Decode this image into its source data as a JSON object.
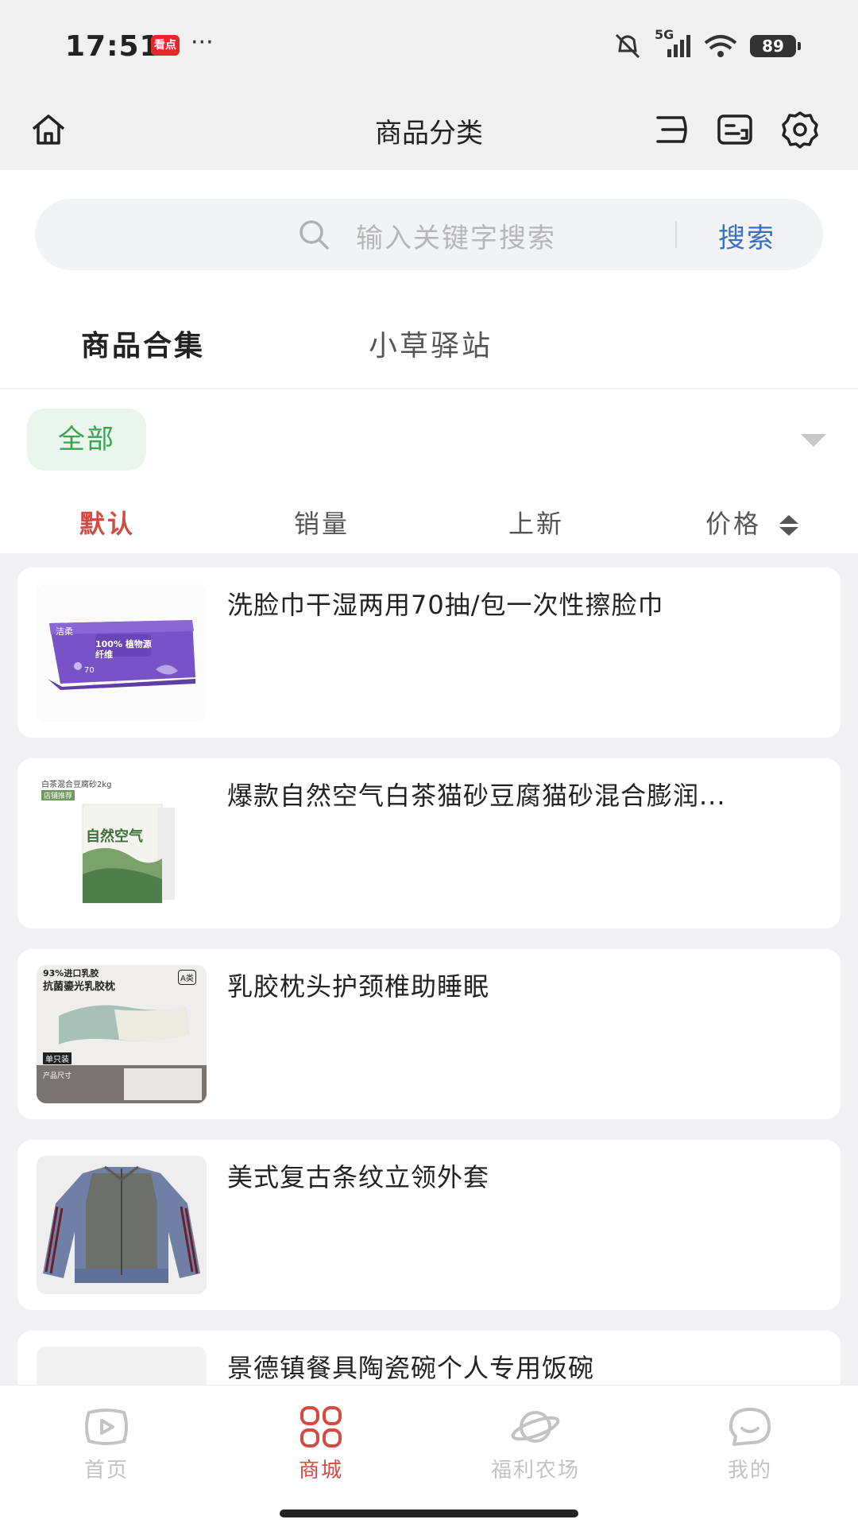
{
  "status_bar": {
    "time": "17:51",
    "badge": "看点",
    "more": "···",
    "network": "5G",
    "battery": "89"
  },
  "header": {
    "title": "商品分类"
  },
  "search": {
    "placeholder": "输入关键字搜索",
    "button": "搜索"
  },
  "tabs": [
    {
      "label": "商品合集"
    },
    {
      "label": "小草驿站"
    }
  ],
  "filter": {
    "chip": "全部"
  },
  "sort": [
    {
      "label": "默认"
    },
    {
      "label": "销量"
    },
    {
      "label": "上新"
    },
    {
      "label": "价格"
    }
  ],
  "products": [
    {
      "title": "洗脸巾干湿两用70抽/包一次性擦脸巾",
      "image_text": "100% 植物源纤维",
      "image_brand": "洁柔",
      "image_count": "70"
    },
    {
      "title": "爆款自然空气白茶猫砂豆腐猫砂混合膨润...",
      "image_caption": "白茶混合豆腐砂2kg",
      "image_tag": "店铺推荐",
      "image_text": "自然空气"
    },
    {
      "title": "乳胶枕头护颈椎助睡眠",
      "image_line1": "93%进口乳胶",
      "image_line2": "抗菌鎏光乳胶枕",
      "image_badge": "A类",
      "image_pack": "单只装",
      "image_size_label": "产品尺寸"
    },
    {
      "title": "美式复古条纹立领外套"
    },
    {
      "title": "景德镇餐具陶瓷碗个人专用饭碗"
    }
  ],
  "tabbar": [
    {
      "label": "首页"
    },
    {
      "label": "商城"
    },
    {
      "label": "福利农场"
    },
    {
      "label": "我的"
    }
  ],
  "colors": {
    "accent_red": "#d04c42",
    "search_blue": "#3a6fc4",
    "chip_green": "#3aa354"
  }
}
